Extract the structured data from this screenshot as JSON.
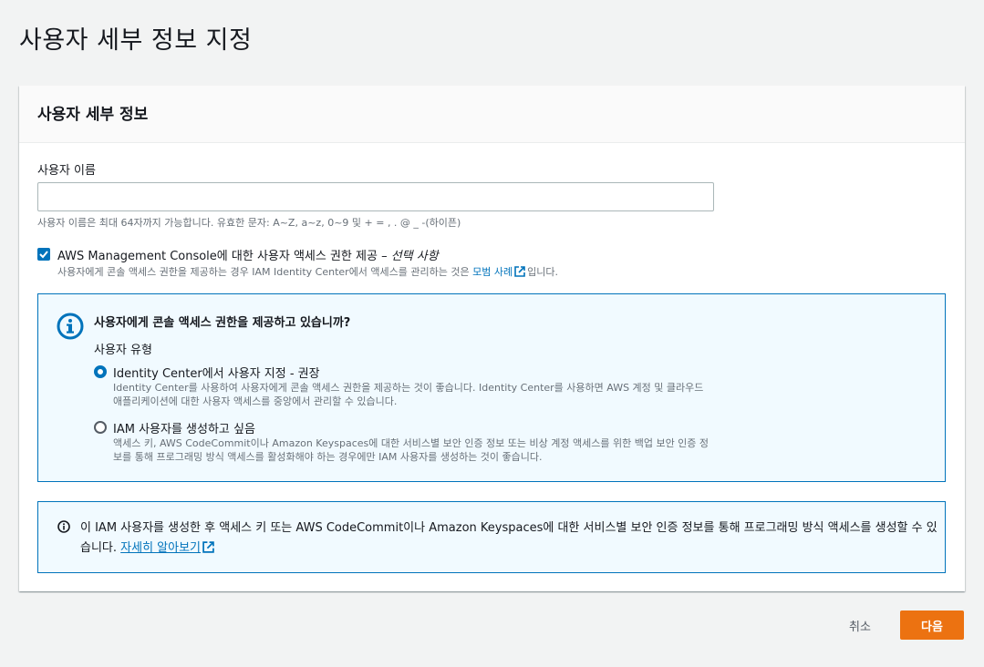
{
  "page": {
    "title": "사용자 세부 정보 지정"
  },
  "card": {
    "title": "사용자 세부 정보",
    "username": {
      "label": "사용자 이름",
      "value": "",
      "hint": "사용자 이름은 최대 64자까지 가능합니다. 유효한 문자: A~Z, a~z, 0~9 및 + = , . @ _ -(하이픈)"
    },
    "console_access": {
      "checked": true,
      "label": "AWS Management Console에 대한 사용자 액세스 권한 제공 –",
      "label_optional": "선택 사항",
      "desc_before": "사용자에게 콘솔 액세스 권한을 제공하는 경우 IAM Identity Center에서 액세스를 관리하는 것은",
      "desc_link": "모범 사례",
      "desc_after": "입니다."
    },
    "info_box": {
      "title": "사용자에게 콘솔 액세스 권한을 제공하고 있습니까?",
      "user_type_label": "사용자 유형",
      "options": [
        {
          "label": "Identity Center에서 사용자 지정 - 권장",
          "desc": "Identity Center를 사용하여 사용자에게 콘솔 액세스 권한을 제공하는 것이 좋습니다. Identity Center를 사용하면 AWS 계정 및 클라우드 애플리케이션에 대한 사용자 액세스를 중앙에서 관리할 수 있습니다.",
          "selected": true
        },
        {
          "label": "IAM 사용자를 생성하고 싶음",
          "desc": "액세스 키, AWS CodeCommit이나 Amazon Keyspaces에 대한 서비스별 보안 인증 정보 또는 비상 계정 액세스를 위한 백업 보안 인증 정보를 통해 프로그래밍 방식 액세스를 활성화해야 하는 경우에만 IAM 사용자를 생성하는 것이 좋습니다.",
          "selected": false
        }
      ]
    },
    "info_box2": {
      "text": "이 IAM 사용자를 생성한 후 액세스 키 또는 AWS CodeCommit이나 Amazon Keyspaces에 대한 서비스별 보안 인증 정보를 통해 프로그래밍 방식 액세스를 생성할 수 있습니다.",
      "link": "자세히 알아보기"
    }
  },
  "footer": {
    "cancel_label": "취소",
    "next_label": "다음"
  },
  "colors": {
    "accent": "#0073bb",
    "primary_button": "#ec7211",
    "info_bg": "#f1faff"
  }
}
